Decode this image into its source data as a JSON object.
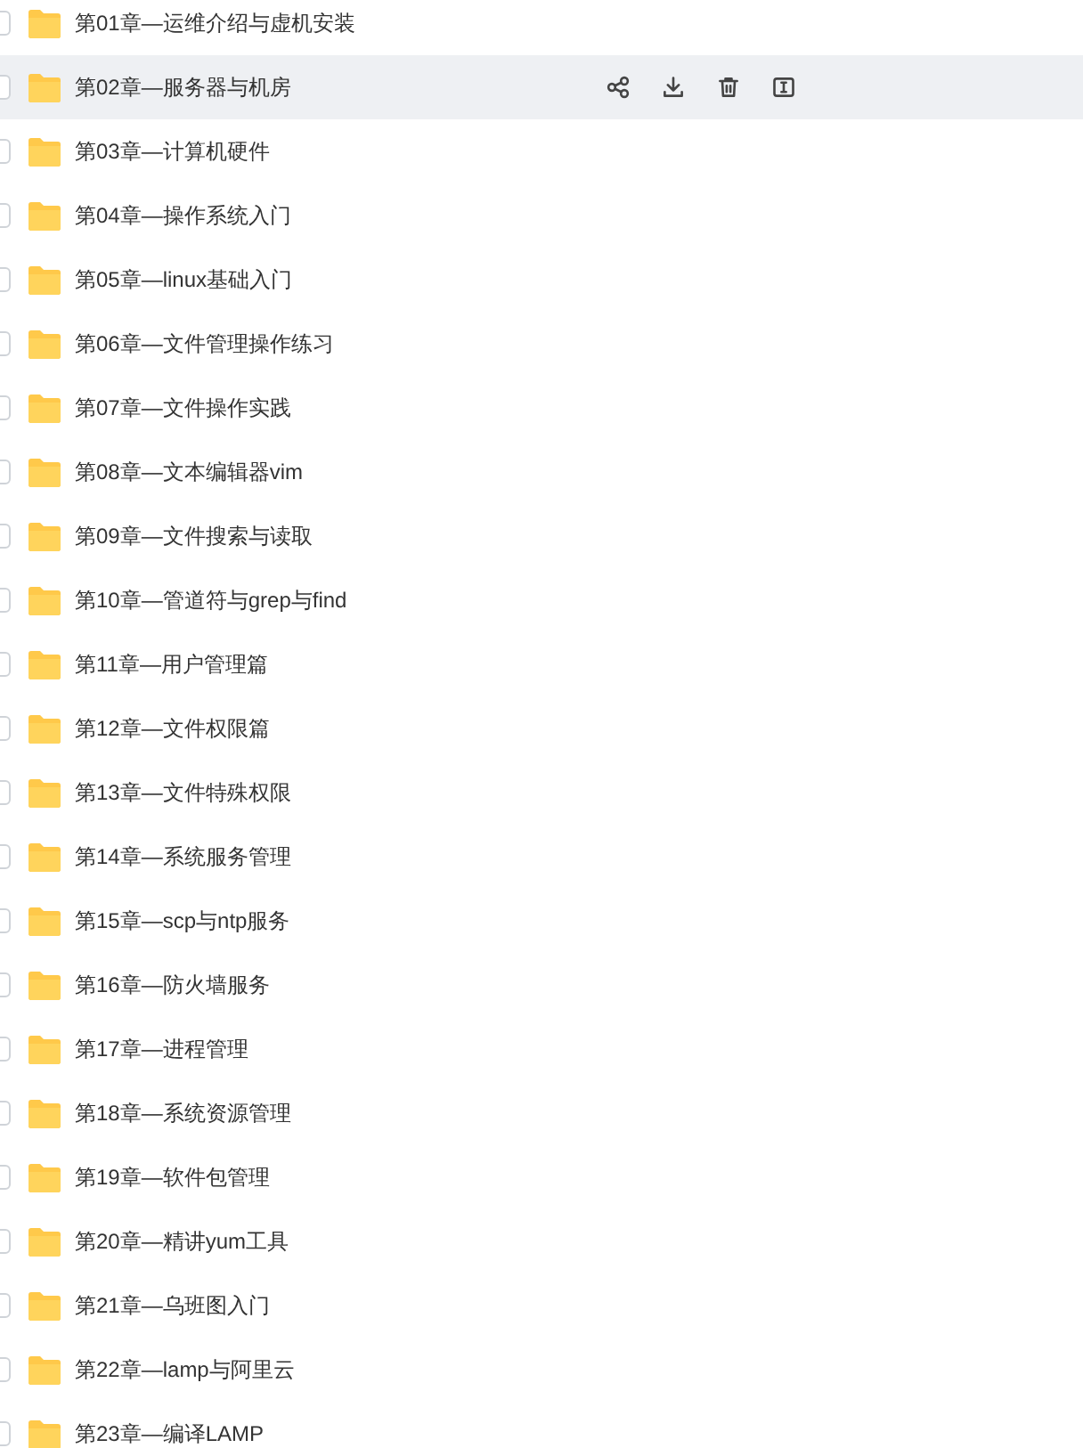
{
  "files": [
    {
      "name": "第01章—运维介绍与虚机安装",
      "checked": false,
      "hovered": false
    },
    {
      "name": "第02章—服务器与机房",
      "checked": false,
      "hovered": true,
      "actions": [
        {
          "kind": "share"
        },
        {
          "kind": "download"
        },
        {
          "kind": "delete"
        },
        {
          "kind": "rename"
        }
      ]
    },
    {
      "name": "第03章—计算机硬件",
      "checked": false,
      "hovered": false
    },
    {
      "name": "第04章—操作系统入门",
      "checked": false,
      "hovered": false
    },
    {
      "name": "第05章—linux基础入门",
      "checked": false,
      "hovered": false
    },
    {
      "name": "第06章—文件管理操作练习",
      "checked": false,
      "hovered": false
    },
    {
      "name": "第07章—文件操作实践",
      "checked": false,
      "hovered": false
    },
    {
      "name": "第08章—文本编辑器vim",
      "checked": false,
      "hovered": false
    },
    {
      "name": "第09章—文件搜索与读取",
      "checked": false,
      "hovered": false
    },
    {
      "name": "第10章—管道符与grep与find",
      "checked": false,
      "hovered": false
    },
    {
      "name": "第11章—用户管理篇",
      "checked": false,
      "hovered": false
    },
    {
      "name": "第12章—文件权限篇",
      "checked": false,
      "hovered": false
    },
    {
      "name": "第13章—文件特殊权限",
      "checked": false,
      "hovered": false
    },
    {
      "name": "第14章—系统服务管理",
      "checked": false,
      "hovered": false
    },
    {
      "name": "第15章—scp与ntp服务",
      "checked": false,
      "hovered": false
    },
    {
      "name": "第16章—防火墙服务",
      "checked": false,
      "hovered": false
    },
    {
      "name": "第17章—进程管理",
      "checked": false,
      "hovered": false
    },
    {
      "name": "第18章—系统资源管理",
      "checked": false,
      "hovered": false
    },
    {
      "name": "第19章—软件包管理",
      "checked": false,
      "hovered": false
    },
    {
      "name": "第20章—精讲yum工具",
      "checked": false,
      "hovered": false
    },
    {
      "name": "第21章—乌班图入门",
      "checked": false,
      "hovered": false
    },
    {
      "name": "第22章—lamp与阿里云",
      "checked": false,
      "hovered": false
    },
    {
      "name": "第23章—编译LAMP",
      "checked": false,
      "hovered": false
    }
  ]
}
